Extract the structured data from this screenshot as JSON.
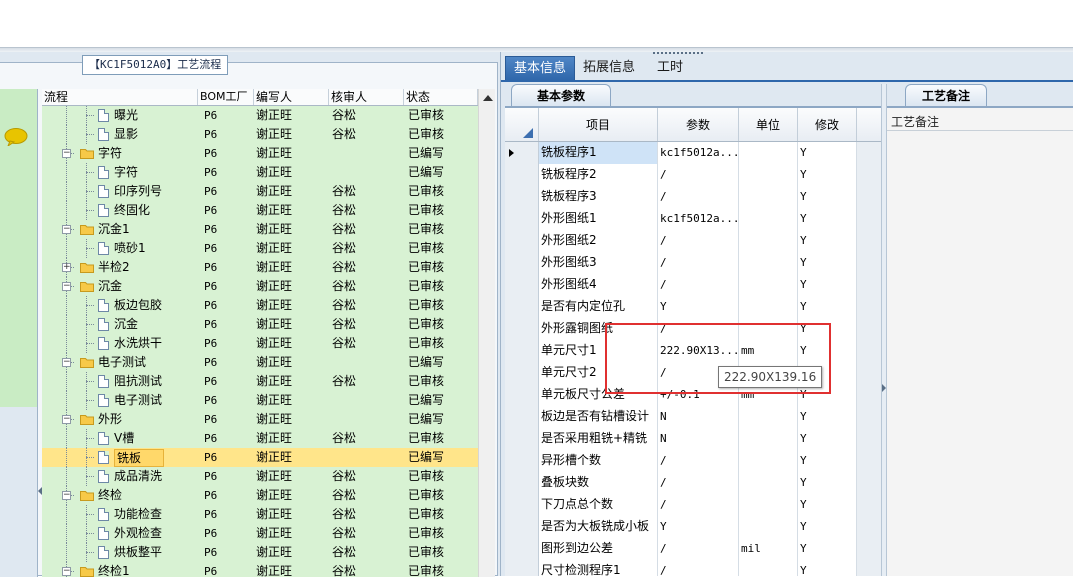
{
  "left_panel": {
    "group_title": "【KC1F5012A0】工艺流程",
    "columns": [
      "流程",
      "BOM工厂",
      "编写人",
      "核审人",
      "状态"
    ],
    "rows": [
      {
        "level": 2,
        "kind": "doc",
        "expanded": null,
        "name": "曝光",
        "bom": "P6",
        "writer": "谢正旺",
        "reviewer": "谷松",
        "status": "已审核"
      },
      {
        "level": 2,
        "kind": "doc",
        "expanded": null,
        "name": "显影",
        "bom": "P6",
        "writer": "谢正旺",
        "reviewer": "谷松",
        "status": "已审核"
      },
      {
        "level": 1,
        "kind": "folder",
        "expanded": true,
        "name": "字符",
        "bom": "P6",
        "writer": "谢正旺",
        "reviewer": "",
        "status": "已编写"
      },
      {
        "level": 2,
        "kind": "doc",
        "expanded": null,
        "name": "字符",
        "bom": "P6",
        "writer": "谢正旺",
        "reviewer": "",
        "status": "已编写"
      },
      {
        "level": 2,
        "kind": "doc",
        "expanded": null,
        "name": "印序列号",
        "bom": "P6",
        "writer": "谢正旺",
        "reviewer": "谷松",
        "status": "已审核"
      },
      {
        "level": 2,
        "kind": "doc",
        "expanded": null,
        "name": "终固化",
        "bom": "P6",
        "writer": "谢正旺",
        "reviewer": "谷松",
        "status": "已审核"
      },
      {
        "level": 1,
        "kind": "folder",
        "expanded": true,
        "name": "沉金1",
        "bom": "P6",
        "writer": "谢正旺",
        "reviewer": "谷松",
        "status": "已审核"
      },
      {
        "level": 2,
        "kind": "doc",
        "expanded": null,
        "name": "喷砂1",
        "bom": "P6",
        "writer": "谢正旺",
        "reviewer": "谷松",
        "status": "已审核"
      },
      {
        "level": 1,
        "kind": "folder",
        "expanded": false,
        "name": "半检2",
        "bom": "P6",
        "writer": "谢正旺",
        "reviewer": "谷松",
        "status": "已审核"
      },
      {
        "level": 1,
        "kind": "folder",
        "expanded": true,
        "name": "沉金",
        "bom": "P6",
        "writer": "谢正旺",
        "reviewer": "谷松",
        "status": "已审核"
      },
      {
        "level": 2,
        "kind": "doc",
        "expanded": null,
        "name": "板边包胶",
        "bom": "P6",
        "writer": "谢正旺",
        "reviewer": "谷松",
        "status": "已审核"
      },
      {
        "level": 2,
        "kind": "doc",
        "expanded": null,
        "name": "沉金",
        "bom": "P6",
        "writer": "谢正旺",
        "reviewer": "谷松",
        "status": "已审核"
      },
      {
        "level": 2,
        "kind": "doc",
        "expanded": null,
        "name": "水洗烘干",
        "bom": "P6",
        "writer": "谢正旺",
        "reviewer": "谷松",
        "status": "已审核"
      },
      {
        "level": 1,
        "kind": "folder",
        "expanded": true,
        "name": "电子测试",
        "bom": "P6",
        "writer": "谢正旺",
        "reviewer": "",
        "status": "已编写"
      },
      {
        "level": 2,
        "kind": "doc",
        "expanded": null,
        "name": "阻抗测试",
        "bom": "P6",
        "writer": "谢正旺",
        "reviewer": "谷松",
        "status": "已审核"
      },
      {
        "level": 2,
        "kind": "doc",
        "expanded": null,
        "name": "电子测试",
        "bom": "P6",
        "writer": "谢正旺",
        "reviewer": "",
        "status": "已编写"
      },
      {
        "level": 1,
        "kind": "folder",
        "expanded": true,
        "name": "外形",
        "bom": "P6",
        "writer": "谢正旺",
        "reviewer": "",
        "status": "已编写"
      },
      {
        "level": 2,
        "kind": "doc",
        "expanded": null,
        "name": "V槽",
        "bom": "P6",
        "writer": "谢正旺",
        "reviewer": "谷松",
        "status": "已审核"
      },
      {
        "level": 2,
        "kind": "doc",
        "expanded": null,
        "name": "铣板",
        "bom": "P6",
        "writer": "谢正旺",
        "reviewer": "",
        "status": "已编写",
        "selected": true
      },
      {
        "level": 2,
        "kind": "doc",
        "expanded": null,
        "name": "成品清洗",
        "bom": "P6",
        "writer": "谢正旺",
        "reviewer": "谷松",
        "status": "已审核"
      },
      {
        "level": 1,
        "kind": "folder",
        "expanded": true,
        "name": "终检",
        "bom": "P6",
        "writer": "谢正旺",
        "reviewer": "谷松",
        "status": "已审核"
      },
      {
        "level": 2,
        "kind": "doc",
        "expanded": null,
        "name": "功能检查",
        "bom": "P6",
        "writer": "谢正旺",
        "reviewer": "谷松",
        "status": "已审核"
      },
      {
        "level": 2,
        "kind": "doc",
        "expanded": null,
        "name": "外观检查",
        "bom": "P6",
        "writer": "谢正旺",
        "reviewer": "谷松",
        "status": "已审核"
      },
      {
        "level": 2,
        "kind": "doc",
        "expanded": null,
        "name": "烘板整平",
        "bom": "P6",
        "writer": "谢正旺",
        "reviewer": "谷松",
        "status": "已审核"
      },
      {
        "level": 1,
        "kind": "folder",
        "expanded": true,
        "name": "终检1",
        "bom": "P6",
        "writer": "谢正旺",
        "reviewer": "谷松",
        "status": "已审核"
      }
    ]
  },
  "right_panel": {
    "tabs": [
      {
        "label": "基本信息",
        "active": true
      },
      {
        "label": "拓展信息",
        "active": false
      },
      {
        "label": "工时",
        "active": false
      }
    ],
    "params_tab": "基本参数",
    "notes_tab": "工艺备注",
    "notes_label": "工艺备注",
    "columns": [
      "项目",
      "参数",
      "单位",
      "修改"
    ],
    "rows": [
      {
        "item": "铣板程序1",
        "param": "kc1f5012a...",
        "unit": "",
        "mod": "Y",
        "current": true
      },
      {
        "item": "铣板程序2",
        "param": "/",
        "unit": "",
        "mod": "Y"
      },
      {
        "item": "铣板程序3",
        "param": "/",
        "unit": "",
        "mod": "Y"
      },
      {
        "item": "外形图纸1",
        "param": "kc1f5012a...",
        "unit": "",
        "mod": "Y"
      },
      {
        "item": "外形图纸2",
        "param": "/",
        "unit": "",
        "mod": "Y"
      },
      {
        "item": "外形图纸3",
        "param": "/",
        "unit": "",
        "mod": "Y"
      },
      {
        "item": "外形图纸4",
        "param": "/",
        "unit": "",
        "mod": "Y"
      },
      {
        "item": "是否有内定位孔",
        "param": "Y",
        "unit": "",
        "mod": "Y"
      },
      {
        "item": "外形露铜图纸",
        "param": "/",
        "unit": "",
        "mod": "Y"
      },
      {
        "item": "单元尺寸1",
        "param": "222.90X13...",
        "unit": "mm",
        "mod": "Y"
      },
      {
        "item": "单元尺寸2",
        "param": "/",
        "unit": "",
        "mod": "Y"
      },
      {
        "item": "单元板尺寸公差",
        "param": "+/-0.1",
        "unit": "mm",
        "mod": "Y"
      },
      {
        "item": "板边是否有钻槽设计",
        "param": "N",
        "unit": "",
        "mod": "Y"
      },
      {
        "item": "是否采用粗铣+精铣",
        "param": "N",
        "unit": "",
        "mod": "Y"
      },
      {
        "item": "异形槽个数",
        "param": "/",
        "unit": "",
        "mod": "Y"
      },
      {
        "item": "叠板块数",
        "param": "/",
        "unit": "",
        "mod": "Y"
      },
      {
        "item": "下刀点总个数",
        "param": "/",
        "unit": "",
        "mod": "Y"
      },
      {
        "item": "是否为大板铣成小板",
        "param": "Y",
        "unit": "",
        "mod": "Y"
      },
      {
        "item": "图形到边公差",
        "param": "/",
        "unit": "mil",
        "mod": "Y"
      },
      {
        "item": "尺寸检测程序1",
        "param": "/",
        "unit": "",
        "mod": "Y"
      }
    ],
    "tooltip": "222.90X139.16"
  },
  "colors": {
    "tree_row_bg": "#d8f2d3",
    "selected_row": "#ffe58a",
    "tab_active": "#2f67ab",
    "highlight_box": "#e03030"
  }
}
